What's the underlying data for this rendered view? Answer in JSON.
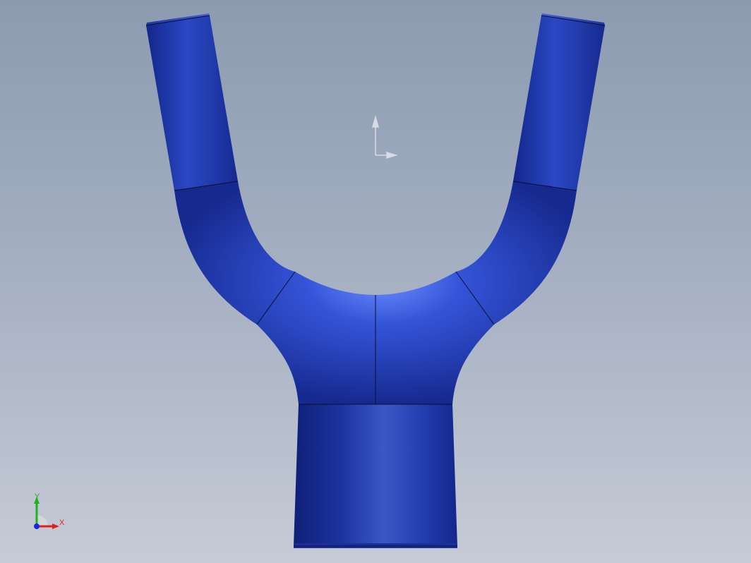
{
  "viewport": {
    "model": {
      "color": "#1f3aa8",
      "highlight_color": "#5a7ff0",
      "edge_color": "#0a0f2e"
    },
    "origin_marker": {
      "color": "#d8dce6"
    },
    "triad": {
      "x_label": "X",
      "y_label": "Y",
      "x_color": "#e02020",
      "y_color": "#20b020",
      "z_color": "#1a2adc"
    }
  }
}
